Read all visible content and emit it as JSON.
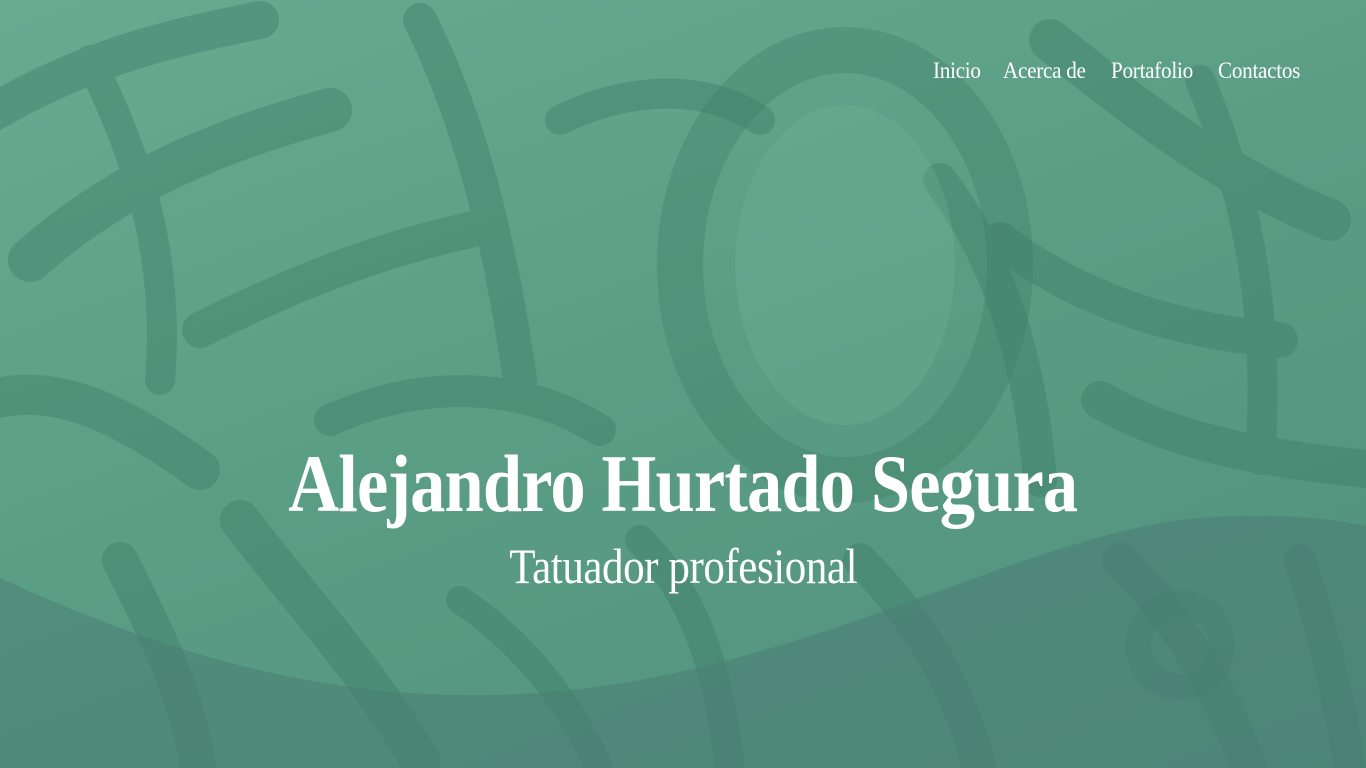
{
  "nav": {
    "items": [
      {
        "label": "Inicio"
      },
      {
        "label": "Acerca de"
      },
      {
        "label": "Portafolio"
      },
      {
        "label": "Contactos"
      }
    ]
  },
  "hero": {
    "title": "Alejandro Hurtado Segura",
    "subtitle": "Tatuador profesional"
  },
  "colors": {
    "background": "#5a9f86",
    "brush_dark": "#3f7f6a",
    "wave_overlay": "#4a7e74",
    "text": "#ffffff"
  }
}
